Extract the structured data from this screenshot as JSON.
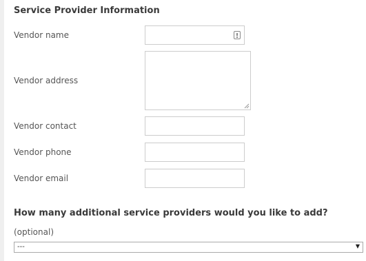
{
  "section": {
    "title": "Service Provider Information"
  },
  "fields": {
    "vendor_name": {
      "label": "Vendor name",
      "value": ""
    },
    "vendor_address": {
      "label": "Vendor address",
      "value": ""
    },
    "vendor_contact": {
      "label": "Vendor contact",
      "value": ""
    },
    "vendor_phone": {
      "label": "Vendor phone",
      "value": ""
    },
    "vendor_email": {
      "label": "Vendor email",
      "value": ""
    }
  },
  "additional": {
    "question": "How many additional service providers would you like to add?",
    "hint": "(optional)",
    "selected": "---",
    "arrow": "▼"
  },
  "icons": {
    "autofill": "autofill-icon",
    "resize": "resize-grip-icon",
    "dropdown": "dropdown-arrow-icon"
  }
}
